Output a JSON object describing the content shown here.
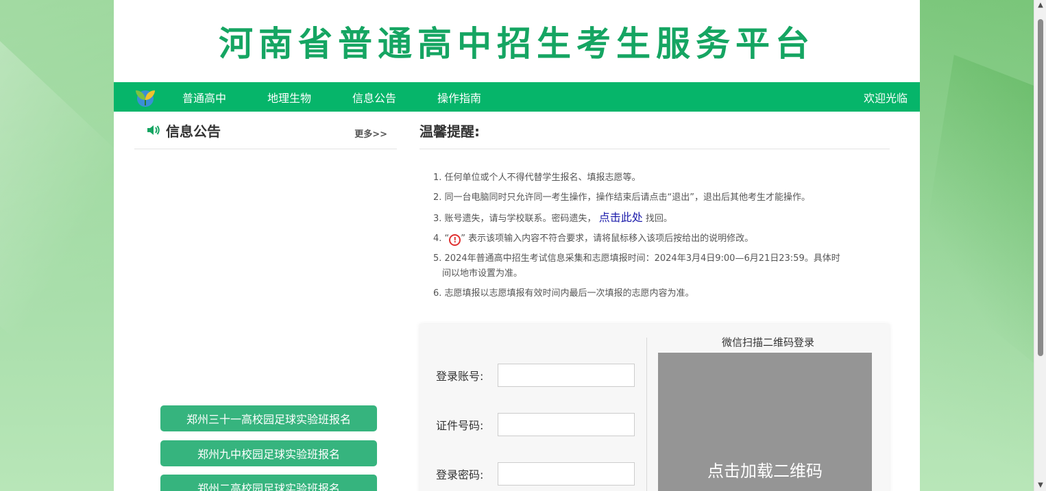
{
  "header": {
    "title": "河南省普通高中招生考生服务平台"
  },
  "nav": {
    "items": [
      "普通高中",
      "地理生物",
      "信息公告",
      "操作指南"
    ],
    "welcome": "欢迎光临"
  },
  "announcements": {
    "title": "信息公告",
    "more": "更多>>",
    "buttons": [
      "郑州三十一高校园足球实验班报名",
      "郑州九中校园足球实验班报名",
      "郑州二高校园足球实验班报名"
    ]
  },
  "tips": {
    "title": "温馨提醒:",
    "items": {
      "t1": "1. 任何单位或个人不得代替学生报名、填报志愿等。",
      "t2": "2. 同一台电脑同时只允许同一考生操作，操作结束后请点击“退出”，退出后其他考生才能操作。",
      "t3_pre": "3. 账号遗失，请与学校联系。密码遗失，",
      "t3_link": "点击此处",
      "t3_post": "找回。",
      "t4_pre": "4. “",
      "t4_icon": "!",
      "t4_post": "” 表示该项输入内容不符合要求，请将鼠标移入该项后按给出的说明修改。",
      "t5_line1": "5. 2024年普通高中招生考试信息采集和志愿填报时间：2024年3月4日9:00—6月21日23:59。具体时",
      "t5_line2": "间以地市设置为准。",
      "t6": "6. 志愿填报以志愿填报有效时间内最后一次填报的志愿内容为准。"
    }
  },
  "login": {
    "account_label": "登录账号:",
    "account_value": "",
    "id_label": "证件号码:",
    "id_value": "",
    "password_label": "登录密码:",
    "password_value": "",
    "qr_title": "微信扫描二维码登录",
    "qr_button": "点击加载二维码"
  },
  "colors": {
    "brand_green": "#06b56a",
    "title_green": "#15a562",
    "button_green": "#36b47e",
    "link_blue": "#1a1aaa",
    "warn_red": "#e03030"
  },
  "icons": {
    "logo": "sprout-logo-icon",
    "announcement": "speaker-icon",
    "warning": "exclamation-circle-icon"
  }
}
